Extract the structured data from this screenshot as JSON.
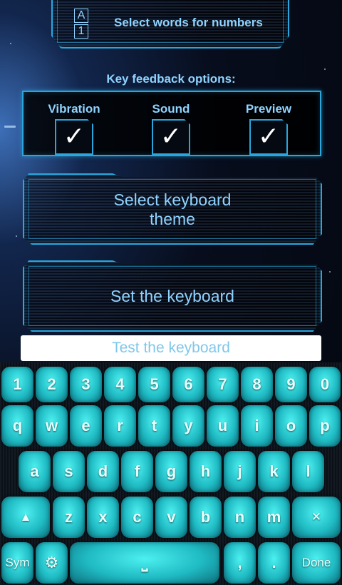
{
  "settings": {
    "select_words_icon_top": "A",
    "select_words_icon_bottom": "1",
    "select_words_label": "Select words for numbers",
    "feedback_title": "Key feedback options:",
    "feedback_options": [
      {
        "label": "Vibration",
        "checked": true
      },
      {
        "label": "Sound",
        "checked": true
      },
      {
        "label": "Preview",
        "checked": true
      }
    ],
    "check_glyph": "✓",
    "theme_button_line1": "Select keyboard",
    "theme_button_line2": "theme",
    "set_button_label": "Set the keyboard",
    "test_placeholder": "Test the keyboard"
  },
  "keyboard": {
    "numbers": [
      "1",
      "2",
      "3",
      "4",
      "5",
      "6",
      "7",
      "8",
      "9",
      "0"
    ],
    "row1": [
      "q",
      "w",
      "e",
      "r",
      "t",
      "y",
      "u",
      "i",
      "o",
      "p"
    ],
    "row2": [
      "a",
      "s",
      "d",
      "f",
      "g",
      "h",
      "j",
      "k",
      "l"
    ],
    "row3": [
      "z",
      "x",
      "c",
      "v",
      "b",
      "n",
      "m"
    ],
    "shift_glyph": "▲",
    "backspace_glyph": "✕",
    "sym_label": "Sym",
    "settings_glyph": "⚙",
    "space_glyph": "⎵",
    "comma": ",",
    "period": ".",
    "done_label": "Done"
  },
  "colors": {
    "accent": "#2aa6dd",
    "text": "#8fd3ff",
    "key": "#1fbac3"
  }
}
